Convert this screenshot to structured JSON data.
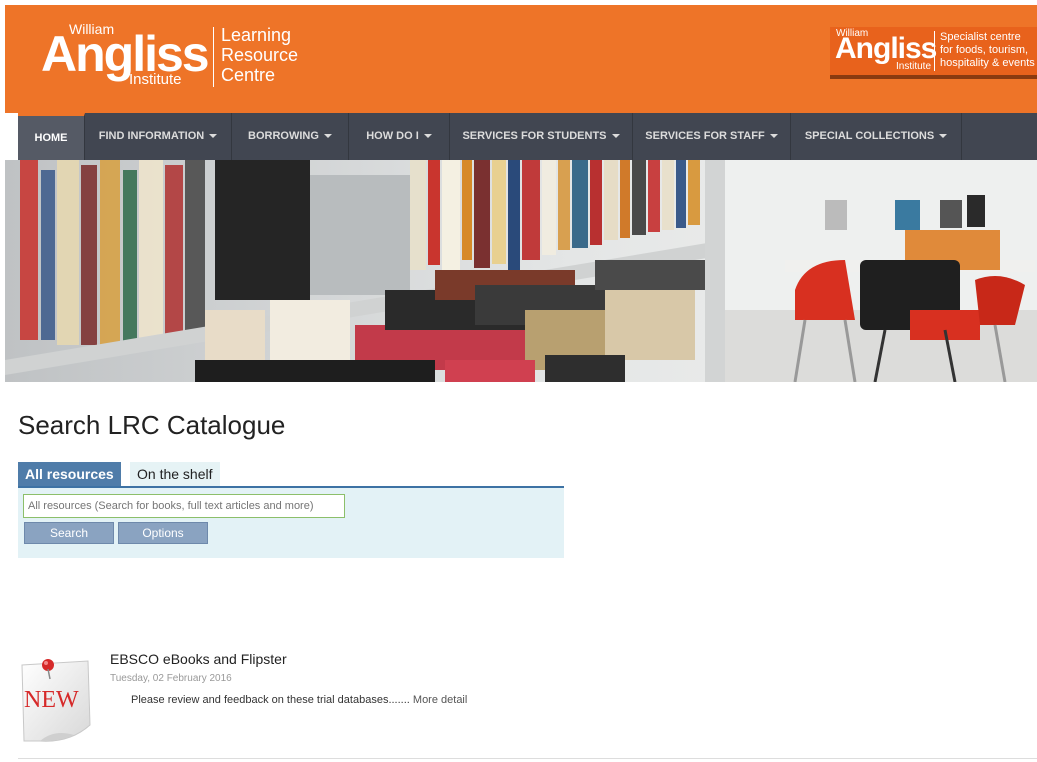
{
  "header": {
    "logo_william": "William",
    "logo_angliss": "Angliss",
    "logo_institute": "Institute",
    "lrc_line1": "Learning",
    "lrc_line2": "Resource",
    "lrc_line3": "Centre",
    "right_william": "William",
    "right_angliss": "Angliss",
    "right_institute": "Institute",
    "tagline_1": "Specialist centre",
    "tagline_2": "for foods, tourism,",
    "tagline_3": "hospitality & events",
    "color": "#ee7428"
  },
  "nav": {
    "items": [
      {
        "label": "HOME",
        "active": true
      },
      {
        "label": "FIND INFORMATION"
      },
      {
        "label": "BORROWING"
      },
      {
        "label": "HOW DO I"
      },
      {
        "label": "SERVICES FOR STUDENTS"
      },
      {
        "label": "SERVICES FOR STAFF"
      },
      {
        "label": "SPECIAL COLLECTIONS"
      }
    ]
  },
  "search": {
    "title": "Search LRC Catalogue",
    "tab_all": "All resources",
    "tab_shelf": "On the shelf",
    "placeholder": "All resources (Search for books, full text articles and more)",
    "search_btn": "Search",
    "options_btn": "Options"
  },
  "news": {
    "icon_text": "NEW",
    "title": "EBSCO eBooks and Flipster",
    "date": "Tuesday, 02 February 2016",
    "desc": "Please review and feedback on these trial databases.......",
    "more": "More detail"
  }
}
